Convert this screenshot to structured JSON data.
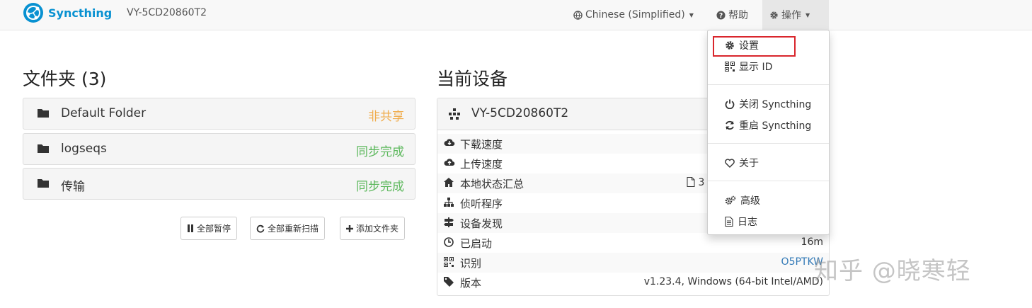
{
  "navbar": {
    "brand": "Syncthing",
    "device_name": "VY-5CD20860T2",
    "language": "Chinese (Simplified)",
    "help": "帮助",
    "actions": "操作"
  },
  "folders": {
    "title": "文件夹 (3)",
    "items": [
      {
        "name": "Default Folder",
        "status": "非共享"
      },
      {
        "name": "logseqs",
        "status": "同步完成"
      },
      {
        "name": "传输",
        "status": "同步完成"
      }
    ],
    "buttons": {
      "pause_all": "全部暂停",
      "rescan_all": "全部重新扫描",
      "add_folder": "添加文件夹"
    }
  },
  "this_device": {
    "title": "当前设备",
    "name": "VY-5CD20860T2",
    "rows": [
      {
        "label": "下载速度",
        "value": ""
      },
      {
        "label": "上传速度",
        "value": ""
      },
      {
        "label": "本地状态汇总",
        "value": "3"
      },
      {
        "label": "侦听程序",
        "value": ""
      },
      {
        "label": "设备发现",
        "value": ""
      },
      {
        "label": "已启动",
        "value": "16m"
      },
      {
        "label": "识别",
        "value": "O5PTKW"
      },
      {
        "label": "版本",
        "value": "v1.23.4, Windows (64-bit Intel/AMD)"
      }
    ]
  },
  "actions_menu": {
    "items": [
      {
        "label": "设置"
      },
      {
        "label": "显示 ID"
      },
      {
        "label": "关闭 Syncthing"
      },
      {
        "label": "重启 Syncthing"
      },
      {
        "label": "关于"
      },
      {
        "label": "高级"
      },
      {
        "label": "日志"
      }
    ]
  },
  "watermark": "知乎 @晓寒轻",
  "colors": {
    "brand": "#0891d1",
    "status_warning": "#f0ad4e",
    "status_ok": "#5cb85c",
    "highlight_box": "#d9262c",
    "link": "#337ab7"
  }
}
